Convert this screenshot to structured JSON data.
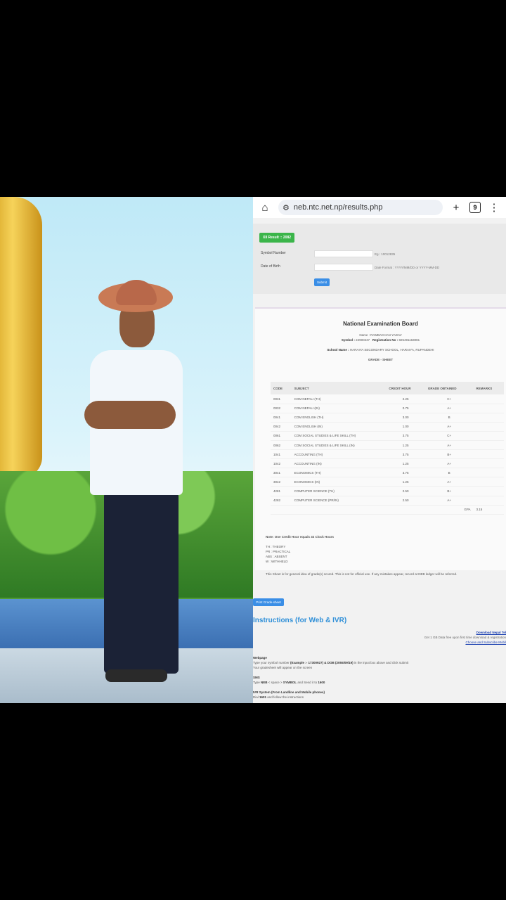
{
  "browser": {
    "url": "neb.ntc.net.np/results.php",
    "tab_count": "9",
    "icons": [
      "home-icon",
      "site-settings-icon",
      "add-tab-icon",
      "more-icon"
    ]
  },
  "form": {
    "badge": "XII Result :: 2082",
    "symbol_label": "Symbol Number",
    "symbol_hint": "Eg.: 10012835",
    "dob_label": "Date of Birth",
    "dob_hint": "Date Format : YYYY/MM/DD or YYYY-MM-DD",
    "submit_label": "Submit"
  },
  "sheet": {
    "board": "National Examination Board",
    "name_line": "Name : RAMBACHAN YADAV",
    "symbol_line_label": "Symbol : ",
    "symbol_value": "24900237",
    "reg_label": "Registration No : ",
    "reg_value": "825491163081",
    "school_label": "School Name : ",
    "school_value": "HARAIYA SECONDARY SCHOOL, HARAIYA, RUPANDEHI",
    "grade_sheet": "GRADE - SHEET",
    "headers": {
      "code": "CODE",
      "subject": "SUBJECT",
      "credit": "CREDIT HOUR",
      "grade": "GRADE OBTAINED",
      "remarks": "REMARKS"
    },
    "rows": [
      {
        "code": "0031",
        "subject": "COM NEPALI (TH)",
        "credit": "2.25",
        "grade": "C+"
      },
      {
        "code": "0032",
        "subject": "COM NEPALI (IN)",
        "credit": "0.75",
        "grade": "A+"
      },
      {
        "code": "0041",
        "subject": "COM ENGLISH (TH)",
        "credit": "3.00",
        "grade": "B"
      },
      {
        "code": "0042",
        "subject": "COM ENGLISH (IN)",
        "credit": "1.00",
        "grade": "A+"
      },
      {
        "code": "0061",
        "subject": "COM SOCIAL STUDIES & LIFE SKILL (TH)",
        "credit": "3.75",
        "grade": "C+"
      },
      {
        "code": "0062",
        "subject": "COM SOCIAL STUDIES & LIFE SKILL (IN)",
        "credit": "1.25",
        "grade": "A+"
      },
      {
        "code": "1041",
        "subject": "ACCOUNTING (TH)",
        "credit": "3.75",
        "grade": "B+"
      },
      {
        "code": "1042",
        "subject": "ACCOUNTING (IN)",
        "credit": "1.25",
        "grade": "A+"
      },
      {
        "code": "3041",
        "subject": "ECONOMICS (TH)",
        "credit": "3.75",
        "grade": "B"
      },
      {
        "code": "3042",
        "subject": "ECONOMICS (IN)",
        "credit": "1.25",
        "grade": "A+"
      },
      {
        "code": "4281",
        "subject": "COMPUTER SCIENCE (TH)",
        "credit": "2.50",
        "grade": "B+"
      },
      {
        "code": "4282",
        "subject": "COMPUTER SCIENCE (PR/IN)",
        "credit": "2.50",
        "grade": "A+"
      }
    ],
    "gpa_label": "GPA",
    "gpa_value": "3.15",
    "note": "Note: One Credit Hour equals 32 Clock Hours",
    "legend": [
      "TH : THEORY",
      "PR : PRACTICAL",
      "ABS : ABSENT",
      "W : WITHHELD"
    ],
    "disclaimer": "This Sheet is for general idea of grade(s) scored. This is not for official use. If any mistakes appear, record at NEB ledger will be referred."
  },
  "footer": {
    "print_label": "Print Grade-sheet",
    "instructions_title": "Instructions (for Web & IVR)",
    "download_link": "Download Nepal Tel",
    "data_line": "Get 1 GB Data free upon first time download & registration",
    "subscribe_link": "Choose and Subscribe Mobil",
    "webpage_title": "Webpage",
    "webpage_line1_pre": "Type your symbol number ",
    "webpage_line1_bold": "(Example :- 17300927) & DOB (2055/09/19)",
    "webpage_line1_post": " in the input box above and click submit",
    "webpage_line2": "Your gradesheet will appear on the screen",
    "sms_title": "SMS",
    "sms_line_pre": "Type ",
    "sms_line_bold1": "NEB",
    "sms_line_mid": " < space > ",
    "sms_line_bold2": "SYMBOL",
    "sms_line_post": " and Send it to ",
    "sms_number": "1600",
    "ivr_title": "IVR System (From Landline and Mobile phones)",
    "ivr_line_pre": "Dial ",
    "ivr_number": "1601",
    "ivr_line_post": " and follow the instructions"
  }
}
